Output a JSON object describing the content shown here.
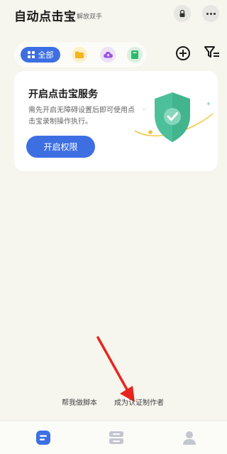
{
  "header": {
    "title": "自动点击宝",
    "subtitle": "解放双手"
  },
  "filters": {
    "all_label": "全部"
  },
  "service_card": {
    "title": "开启点击宝服务",
    "description": "需先开启无障碍设置后即可使用点击宝录制操作执行。",
    "button_label": "开启权限"
  },
  "footer_links": {
    "help": "帮我做脚本",
    "author": "成为认证制作者"
  },
  "icons": {
    "lock": "lock-icon",
    "more": "more-dots-icon",
    "add": "plus-circle-icon",
    "filter": "filter-list-icon",
    "shield": "shield-check-icon",
    "tab_home": "script-tab-icon",
    "tab_library": "library-tab-icon",
    "tab_profile": "user-icon"
  },
  "colors": {
    "accent": "#3d6fe3",
    "background": "#f6f5ee",
    "shield": "#4cc09a",
    "arrow": "#e8251d"
  }
}
